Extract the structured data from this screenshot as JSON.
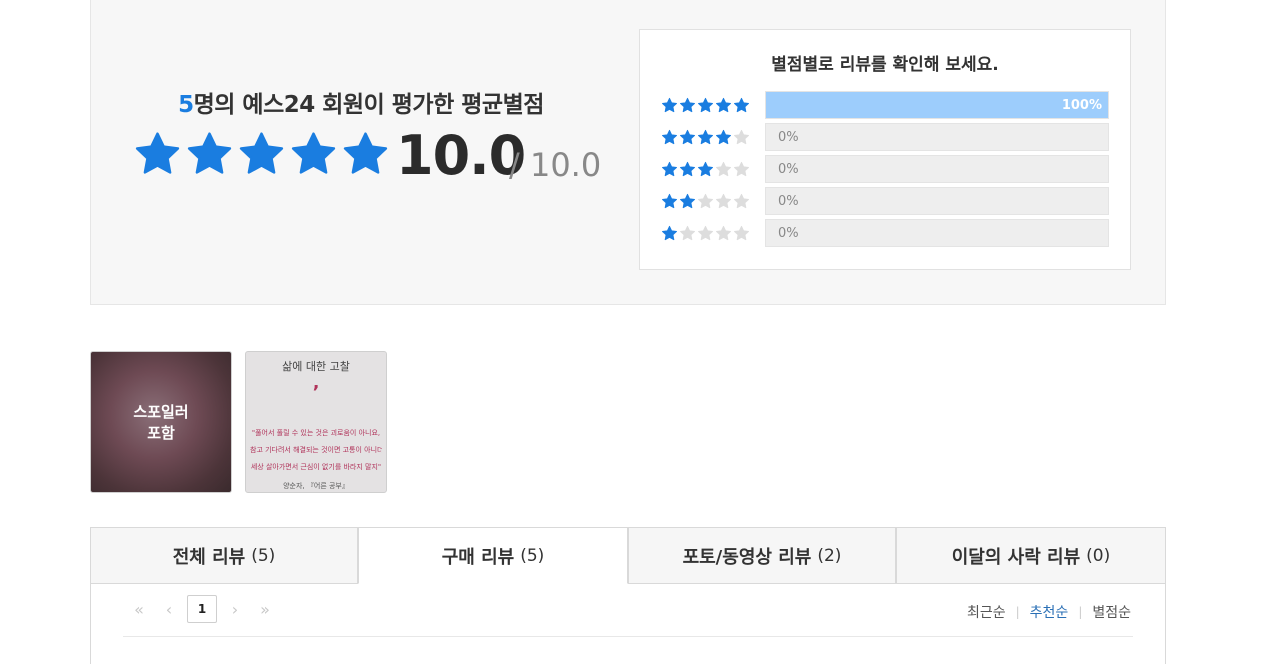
{
  "summary": {
    "title_count": "5",
    "title_rest": "명의 예스24 회원이 평가한 평균별점",
    "avg_score": "10.0",
    "max_score": "/ 10.0",
    "star_rating": 5,
    "accent_color": "#1a7de0"
  },
  "distribution": {
    "title": "별점별로 리뷰를 확인해 보세요.",
    "rows": [
      {
        "stars": 5,
        "percent": 100,
        "label": "100%"
      },
      {
        "stars": 4,
        "percent": 0,
        "label": "0%"
      },
      {
        "stars": 3,
        "percent": 0,
        "label": "0%"
      },
      {
        "stars": 2,
        "percent": 0,
        "label": "0%"
      },
      {
        "stars": 1,
        "percent": 0,
        "label": "0%"
      }
    ]
  },
  "photos": {
    "spoiler_line1": "스포일러",
    "spoiler_line2": "포함",
    "photo2_title": "삶에 대한 고찰",
    "photo2_mark": "’",
    "photo2_lines": [
      "\"풀어서 풀릴 수 있는 것은 괴로움이 아니요,",
      "참고 기다려서 해결되는 것이면 고통이 아니더라,",
      "세상 살아가면서 근심이 없기를 바라지 말지\""
    ],
    "photo2_source": "양순자, 『어른 공부』"
  },
  "tabs": [
    {
      "label": "전체 리뷰",
      "count": "(5)",
      "active": false
    },
    {
      "label": "구매 리뷰",
      "count": "(5)",
      "active": true
    },
    {
      "label": "포토/동영상 리뷰",
      "count": "(2)",
      "active": false
    },
    {
      "label": "이달의 사락 리뷰",
      "count": "(0)",
      "active": false
    }
  ],
  "pagination": {
    "current_page": "1"
  },
  "sort": {
    "options": [
      "최근순",
      "추천순",
      "별점순"
    ],
    "selected": "추천순"
  },
  "icons": {
    "star_filled_color": "#1a7de0",
    "star_empty_color": "#dddddd",
    "bar_fill_color": "#9dcdfc"
  }
}
